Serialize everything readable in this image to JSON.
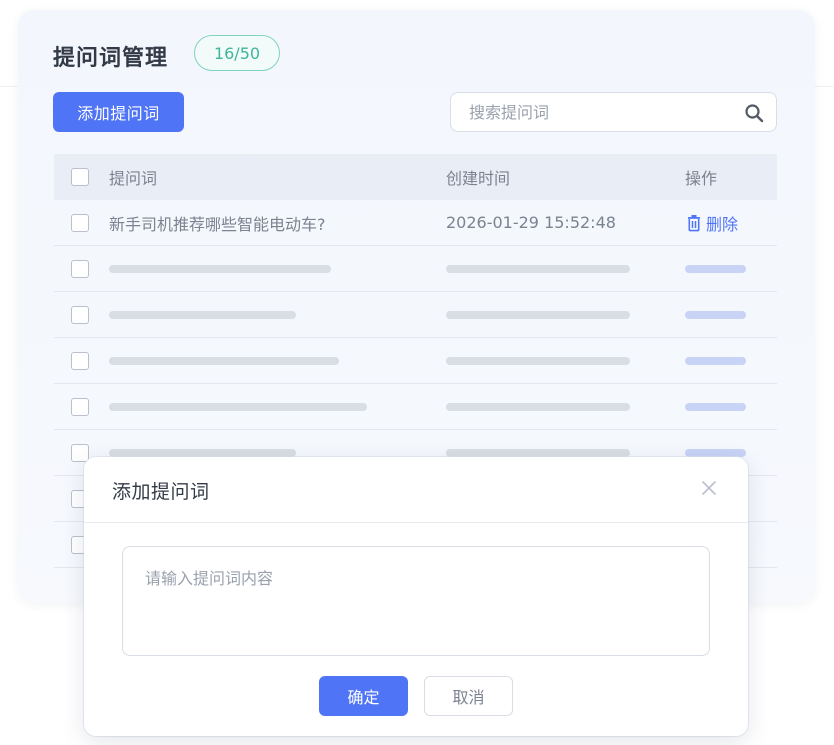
{
  "header": {
    "title": "提问词管理",
    "count": "16/50"
  },
  "toolbar": {
    "add_label": "添加提问词",
    "search_placeholder": "搜索提问词"
  },
  "table": {
    "columns": [
      "提问词",
      "创建时间",
      "操作"
    ],
    "rows": [
      {
        "question": "新手司机推荐哪些智能电动车?",
        "created": "2026-01-29 15:52:48",
        "action": "删除"
      }
    ]
  },
  "modal": {
    "title": "添加提问词",
    "placeholder": "请输入提问词内容",
    "confirm_label": "确定",
    "cancel_label": "取消"
  },
  "colors": {
    "accent": "#4f74f6",
    "count_green": "#3fb59c"
  },
  "icons": {
    "search": "search-icon",
    "delete": "trash-icon",
    "close": "close-icon"
  }
}
